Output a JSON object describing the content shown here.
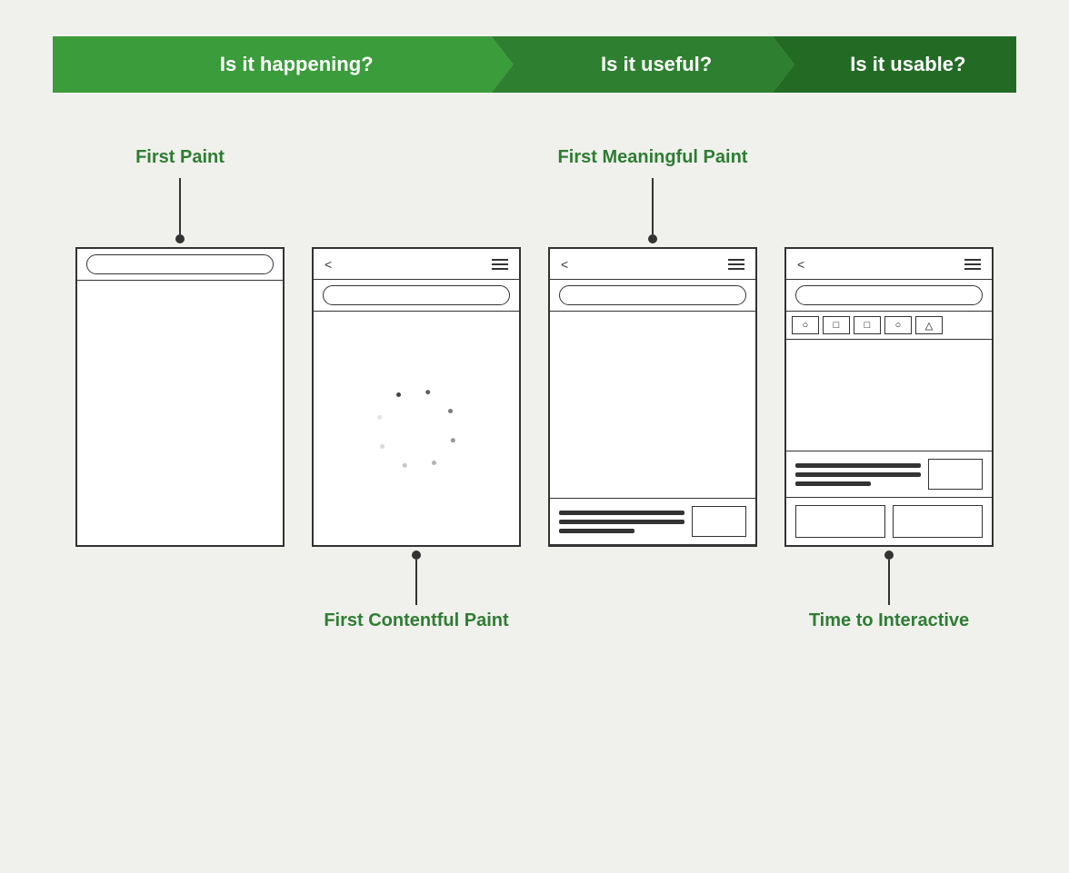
{
  "banner": {
    "segments": [
      {
        "id": "happening",
        "label": "Is it happening?"
      },
      {
        "id": "useful",
        "label": "Is it useful?"
      },
      {
        "id": "usable",
        "label": "Is it usable?"
      }
    ]
  },
  "cards": [
    {
      "id": "first-paint",
      "label_top": "First Paint",
      "label_bottom": null,
      "connector": "top",
      "phone_type": "minimal"
    },
    {
      "id": "first-contentful-paint",
      "label_top": null,
      "label_bottom": "First Contentful Paint",
      "connector": "bottom",
      "phone_type": "loading"
    },
    {
      "id": "first-meaningful-paint",
      "label_top": "First Meaningful Paint",
      "label_bottom": null,
      "connector": "top",
      "phone_type": "content"
    },
    {
      "id": "time-to-interactive",
      "label_top": null,
      "label_bottom": "Time to Interactive",
      "connector": "bottom",
      "phone_type": "full"
    }
  ]
}
